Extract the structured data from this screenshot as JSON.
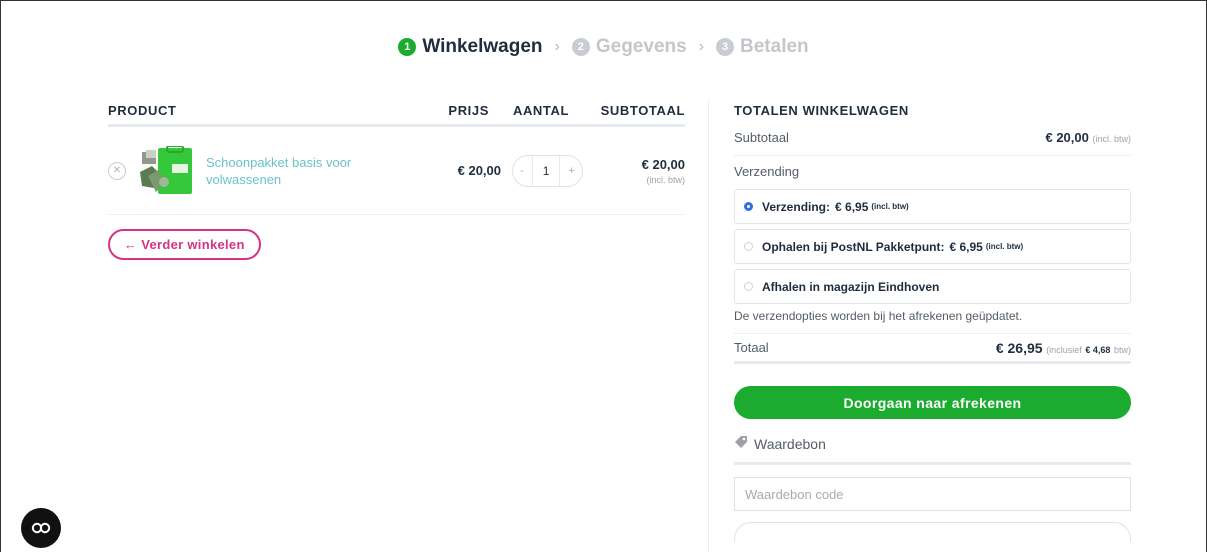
{
  "steps": [
    {
      "num": "1",
      "label": "Winkelwagen",
      "state": "active"
    },
    {
      "num": "2",
      "label": "Gegevens",
      "state": "inactive"
    },
    {
      "num": "3",
      "label": "Betalen",
      "state": "inactive"
    }
  ],
  "cart": {
    "headers": {
      "product": "PRODUCT",
      "price": "PRIJS",
      "quantity": "AANTAL",
      "subtotal": "SUBTOTAAL"
    },
    "items": [
      {
        "name": "Schoonpakket basis voor volwassenen",
        "price": "€ 20,00",
        "quantity": "1",
        "minus": "-",
        "plus": "+",
        "subtotal": "€ 20,00",
        "subtotal_note": "(incl. btw)"
      }
    ],
    "continue_label": "← Verder winkelen"
  },
  "totals": {
    "title": "TOTALEN WINKELWAGEN",
    "subtotal_label": "Subtotaal",
    "subtotal_value": "€ 20,00",
    "subtotal_note": "(incl. btw)",
    "shipping_label": "Verzending",
    "shipping_options": [
      {
        "label": "Verzending:",
        "price": "€ 6,95",
        "note": "(incl. btw)",
        "selected": true
      },
      {
        "label": "Ophalen bij PostNL Pakketpunt:",
        "price": "€ 6,95",
        "note": "(incl. btw)",
        "selected": false
      },
      {
        "label": "Afhalen in magazijn Eindhoven",
        "price": "",
        "note": "",
        "selected": false
      }
    ],
    "shipping_note": "De verzendopties worden bij het afrekenen geüpdatet.",
    "total_label": "Totaal",
    "total_value": "€ 26,95",
    "total_note_prefix": "(inclusief",
    "total_note_tax": "€ 4,68",
    "total_note_suffix": "btw)",
    "checkout_label": "Doorgaan naar afrekenen",
    "voucher_label": "Waardebon",
    "voucher_placeholder": "Waardebon code"
  },
  "colors": {
    "brand_green": "#1aab2f",
    "accent_pink": "#d63384",
    "link_teal": "#6cc3c9",
    "radio_blue": "#2d6fe5"
  },
  "icons": {
    "remove": "close-icon",
    "voucher": "tag-icon",
    "chat": "chat-icon",
    "step_separator": "chevron-right-icon"
  }
}
